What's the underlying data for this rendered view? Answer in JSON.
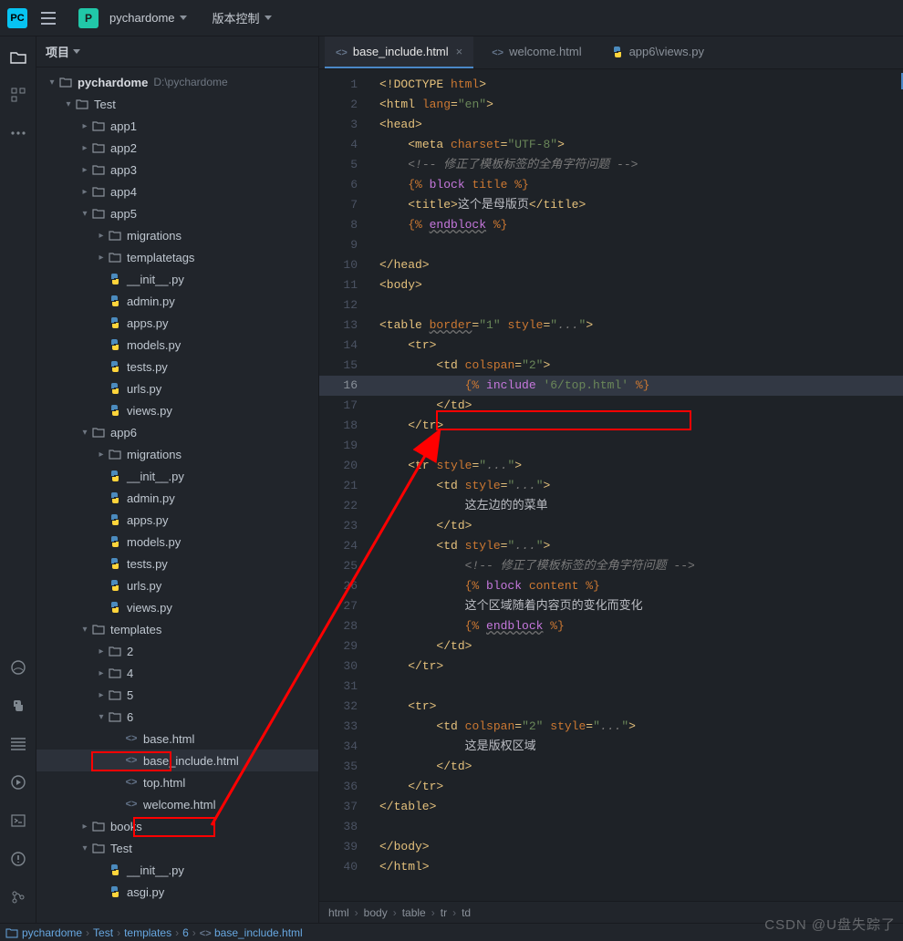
{
  "topbar": {
    "logo": "PC",
    "project_badge": "P",
    "project_name": "pychardome",
    "menu_vcs": "版本控制"
  },
  "sidebar": {
    "title": "项目",
    "root_name": "pychardome",
    "root_path": "D:\\pychardome",
    "tree": {
      "test": "Test",
      "apps": [
        "app1",
        "app2",
        "app3",
        "app4",
        "app5",
        "app6"
      ],
      "migrations": "migrations",
      "templatetags": "templatetags",
      "pyfiles": [
        "__init__.py",
        "admin.py",
        "apps.py",
        "models.py",
        "tests.py",
        "urls.py",
        "views.py"
      ],
      "templates": "templates",
      "tfolders": [
        "2",
        "4",
        "5",
        "6"
      ],
      "tfiles": [
        "base.html",
        "base_include.html",
        "top.html",
        "welcome.html"
      ],
      "books": "books",
      "test2": "Test",
      "test2files": [
        "__init__.py",
        "asgi.py"
      ]
    }
  },
  "tabs": [
    {
      "icon": "<>",
      "label": "base_include.html",
      "active": true,
      "close": true
    },
    {
      "icon": "<>",
      "label": "welcome.html",
      "active": false,
      "close": false
    },
    {
      "icon": "py",
      "label": "app6\\views.py",
      "active": false,
      "close": false
    }
  ],
  "code_lines": {
    "1": {
      "i": 0,
      "h": "<span class='tag'>&lt;!DOCTYPE <span class='attr'>html</span>&gt;</span>"
    },
    "2": {
      "i": 0,
      "h": "<span class='tag'>&lt;html <span class='attr'>lang</span>=<span class='str'>\"en\"</span>&gt;</span>"
    },
    "3": {
      "i": 0,
      "h": "<span class='tag'>&lt;head&gt;</span>"
    },
    "4": {
      "i": 1,
      "h": "<span class='tag'>&lt;meta <span class='attr'>charset</span>=<span class='str'>\"UTF-8\"</span>&gt;</span>"
    },
    "5": {
      "i": 1,
      "h": "<span class='cmt'>&lt;!-- 修正了模板标签的全角字符问题 --&gt;</span>"
    },
    "6": {
      "i": 1,
      "h": "<span class='tpl'>{% </span><span class='tplb'>block</span><span class='tpl'> title %}</span>"
    },
    "7": {
      "i": 1,
      "h": "<span class='tag'>&lt;title&gt;</span><span class='txt'>这个是母版页</span><span class='tag'>&lt;/title&gt;</span>"
    },
    "8": {
      "i": 1,
      "h": "<span class='tpl'>{% </span><span class='tplb endb'>endblock</span><span class='tpl'> %}</span>"
    },
    "9": {
      "i": 0,
      "h": ""
    },
    "10": {
      "i": 0,
      "h": "<span class='tag'>&lt;/head&gt;</span>"
    },
    "11": {
      "i": 0,
      "h": "<span class='tag'>&lt;body&gt;</span>"
    },
    "12": {
      "i": 0,
      "h": ""
    },
    "13": {
      "i": 0,
      "h": "<span class='tag'>&lt;table <span class='attr endb'>border</span>=<span class='str'>\"1\"</span> <span class='attr'>style</span>=<span class='str'>\"</span><span class='cmt'>...</span><span class='str'>\"</span>&gt;</span>"
    },
    "14": {
      "i": 1,
      "h": "<span class='tag'>&lt;tr&gt;</span>"
    },
    "15": {
      "i": 2,
      "h": "<span class='tag'>&lt;td <span class='attr'>colspan</span>=<span class='str'>\"2\"</span>&gt;</span>"
    },
    "16": {
      "i": 3,
      "h": "<span class='tpl'>{% </span><span class='tplb'>include</span><span class='tpl'> </span><span class='str'>'6/top.html'</span><span class='tpl'> %}</span>",
      "hl": true
    },
    "17": {
      "i": 2,
      "h": "<span class='tag'>&lt;/td&gt;</span>"
    },
    "18": {
      "i": 1,
      "h": "<span class='tag'>&lt;/tr&gt;</span>"
    },
    "19": {
      "i": 0,
      "h": ""
    },
    "20": {
      "i": 1,
      "h": "<span class='tag'>&lt;tr <span class='attr'>style</span>=<span class='str'>\"</span><span class='cmt'>...</span><span class='str'>\"</span>&gt;</span>"
    },
    "21": {
      "i": 2,
      "h": "<span class='tag'>&lt;td <span class='attr'>style</span>=<span class='str'>\"</span><span class='cmt'>...</span><span class='str'>\"</span>&gt;</span>"
    },
    "22": {
      "i": 3,
      "h": "<span class='txt'>这左边的的菜单</span>"
    },
    "23": {
      "i": 2,
      "h": "<span class='tag'>&lt;/td&gt;</span>"
    },
    "24": {
      "i": 2,
      "h": "<span class='tag'>&lt;td <span class='attr'>style</span>=<span class='str'>\"</span><span class='cmt'>...</span><span class='str'>\"</span>&gt;</span>"
    },
    "25": {
      "i": 3,
      "h": "<span class='cmt'>&lt;!-- 修正了模板标签的全角字符问题 --&gt;</span>"
    },
    "26": {
      "i": 3,
      "h": "<span class='tpl'>{% </span><span class='tplb'>block</span><span class='tpl'> content %}</span>"
    },
    "27": {
      "i": 3,
      "h": "<span class='txt'>这个区域随着内容页的变化而变化</span>"
    },
    "28": {
      "i": 3,
      "h": "<span class='tpl'>{% </span><span class='tplb endb'>endblock</span><span class='tpl'> %}</span>"
    },
    "29": {
      "i": 2,
      "h": "<span class='tag'>&lt;/td&gt;</span>"
    },
    "30": {
      "i": 1,
      "h": "<span class='tag'>&lt;/tr&gt;</span>"
    },
    "31": {
      "i": 0,
      "h": ""
    },
    "32": {
      "i": 1,
      "h": "<span class='tag'>&lt;tr&gt;</span>"
    },
    "33": {
      "i": 2,
      "h": "<span class='tag'>&lt;td <span class='attr'>colspan</span>=<span class='str'>\"2\"</span> <span class='attr'>style</span>=<span class='str'>\"</span><span class='cmt'>...</span><span class='str'>\"</span>&gt;</span>"
    },
    "34": {
      "i": 3,
      "h": "<span class='txt'>这是版权区域</span>"
    },
    "35": {
      "i": 2,
      "h": "<span class='tag'>&lt;/td&gt;</span>"
    },
    "36": {
      "i": 1,
      "h": "<span class='tag'>&lt;/tr&gt;</span>"
    },
    "37": {
      "i": 0,
      "h": "<span class='tag'>&lt;/table&gt;</span>"
    },
    "38": {
      "i": 0,
      "h": ""
    },
    "39": {
      "i": 0,
      "h": "<span class='tag'>&lt;/body&gt;</span>"
    },
    "40": {
      "i": 0,
      "h": "<span class='tag'>&lt;/html&gt;</span>"
    }
  },
  "crumbs": [
    "html",
    "body",
    "table",
    "tr",
    "td"
  ],
  "status_path": [
    "pychardome",
    "Test",
    "templates",
    "6",
    "base_include.html"
  ],
  "watermark": "CSDN @U盘失踪了"
}
